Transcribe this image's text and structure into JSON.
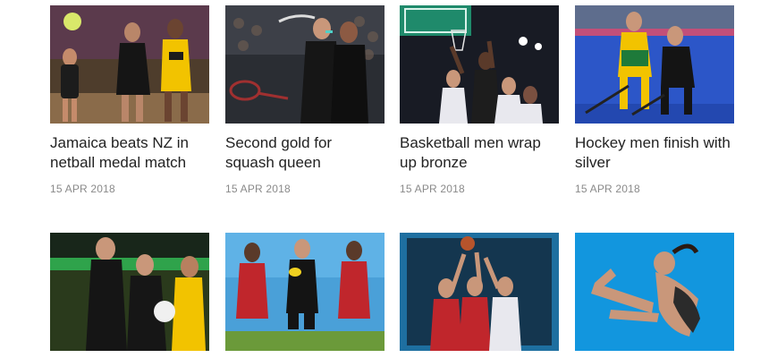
{
  "articles": [
    {
      "title": "Jamaica beats NZ in netball medal match",
      "date": "15 APR 2018",
      "image": "netball-photo"
    },
    {
      "title": "Second gold for squash queen",
      "date": "15 APR 2018",
      "image": "squash-photo"
    },
    {
      "title": "Basketball men wrap up bronze",
      "date": "15 APR 2018",
      "image": "basketball-photo"
    },
    {
      "title": "Hockey men finish with silver",
      "date": "15 APR 2018",
      "image": "hockey-photo"
    },
    {
      "image": "netball-photo"
    },
    {
      "image": "rugby-sevens-photo"
    },
    {
      "image": "womens-basketball-photo"
    },
    {
      "image": "diving-photo"
    }
  ]
}
